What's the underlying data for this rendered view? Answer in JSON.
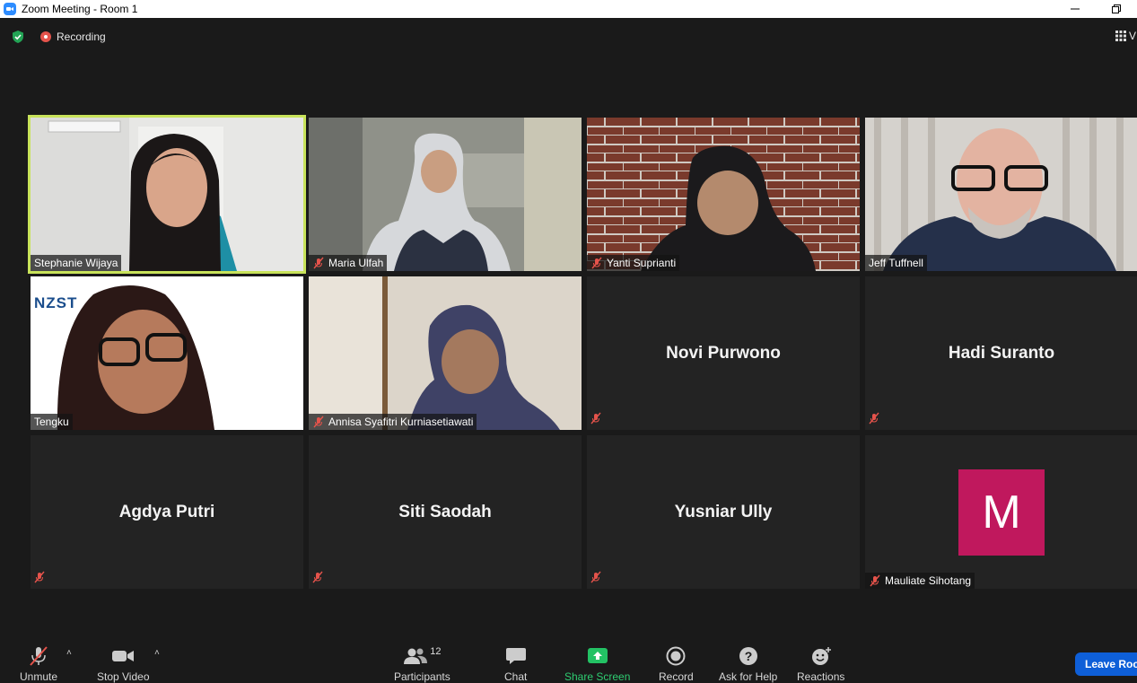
{
  "window": {
    "title": "Zoom Meeting - Room 1"
  },
  "topbar": {
    "recording_label": "Recording",
    "view_label": "V"
  },
  "participants": [
    {
      "name": "Stephanie Wijaya",
      "video": true,
      "muted": false,
      "active": true
    },
    {
      "name": "Maria Ulfah",
      "video": true,
      "muted": true
    },
    {
      "name": "Yanti Suprianti",
      "video": true,
      "muted": true
    },
    {
      "name": "Jeff Tuffnell",
      "video": true,
      "muted": false
    },
    {
      "name": "Tengku",
      "video": true,
      "muted": false,
      "overlay_logo_text": "NZST"
    },
    {
      "name": "Annisa Syafitri Kurniasetiawati",
      "video": true,
      "muted": true
    },
    {
      "name": "Novi Purwono",
      "video": false,
      "muted": true
    },
    {
      "name": "Hadi Suranto",
      "video": false,
      "muted": true
    },
    {
      "name": "Agdya Putri",
      "video": false,
      "muted": true
    },
    {
      "name": "Siti Saodah",
      "video": false,
      "muted": true
    },
    {
      "name": "Yusniar Ully",
      "video": false,
      "muted": true
    },
    {
      "name": "Mauliate Sihotang",
      "video": false,
      "muted": true,
      "avatar_letter": "M",
      "avatar_color": "#c0185d"
    }
  ],
  "toolbar": {
    "unmute": "Unmute",
    "stop_video": "Stop Video",
    "participants": "Participants",
    "participants_count": "12",
    "chat": "Chat",
    "share_screen": "Share Screen",
    "record": "Record",
    "ask_for_help": "Ask for Help",
    "reactions": "Reactions",
    "leave": "Leave Room"
  },
  "colors": {
    "active_speaker_border": "#c8e35a",
    "share_green": "#2ecc71",
    "leave_blue": "#0e5fd8",
    "mute_red": "#e5534b"
  }
}
